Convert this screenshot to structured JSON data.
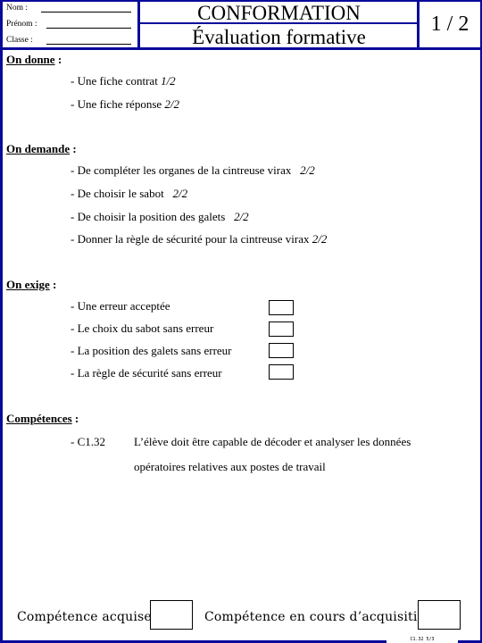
{
  "header": {
    "identity_fields": [
      {
        "label": "Nom :",
        "value": ""
      },
      {
        "label": "Prénom :",
        "value": ""
      },
      {
        "label": "Classe :",
        "value": ""
      }
    ],
    "title": "CONFORMATION",
    "subtitle": "Évaluation formative",
    "page_number": "1 / 2"
  },
  "on_donne": {
    "heading": "On donne",
    "colon": " :",
    "items": [
      {
        "text": "- Une fiche contrat ",
        "ref": "1/2"
      },
      {
        "text": "- Une fiche réponse ",
        "ref": "2/2"
      }
    ]
  },
  "on_demande": {
    "heading": "On demande",
    "colon": " :",
    "items": [
      {
        "text": "- De compléter les organes de la cintreuse virax   ",
        "ref": "2/2"
      },
      {
        "text": "- De choisir le sabot   ",
        "ref": "2/2"
      },
      {
        "text": "- De choisir la position des galets   ",
        "ref": "2/2"
      },
      {
        "text": "- Donner la règle de sécurité pour la cintreuse virax ",
        "ref": "2/2"
      }
    ]
  },
  "on_exige": {
    "heading": "On exige",
    "colon": " :",
    "items": [
      {
        "text": "- Une erreur acceptée",
        "checked": false
      },
      {
        "text": "- Le choix du sabot sans erreur",
        "checked": false
      },
      {
        "text": "- La position des galets sans erreur",
        "checked": false
      },
      {
        "text": "- La règle de sécurité sans erreur",
        "checked": false
      }
    ]
  },
  "competences": {
    "heading": "Compétences",
    "colon": " :",
    "code": "- C1.32",
    "description_line1": "L’élève doit être capable de décoder et analyser les données",
    "description_line2": "opératoires relatives aux postes de travail"
  },
  "footer": {
    "acquired_label": "Compétence acquise",
    "in_progress_label": "Compétence en cours d’acquisition",
    "acquired_checked": false,
    "in_progress_checked": false,
    "tiny_ref": "C1.32  5/3"
  },
  "colors": {
    "frame": "#0a0a9a"
  }
}
